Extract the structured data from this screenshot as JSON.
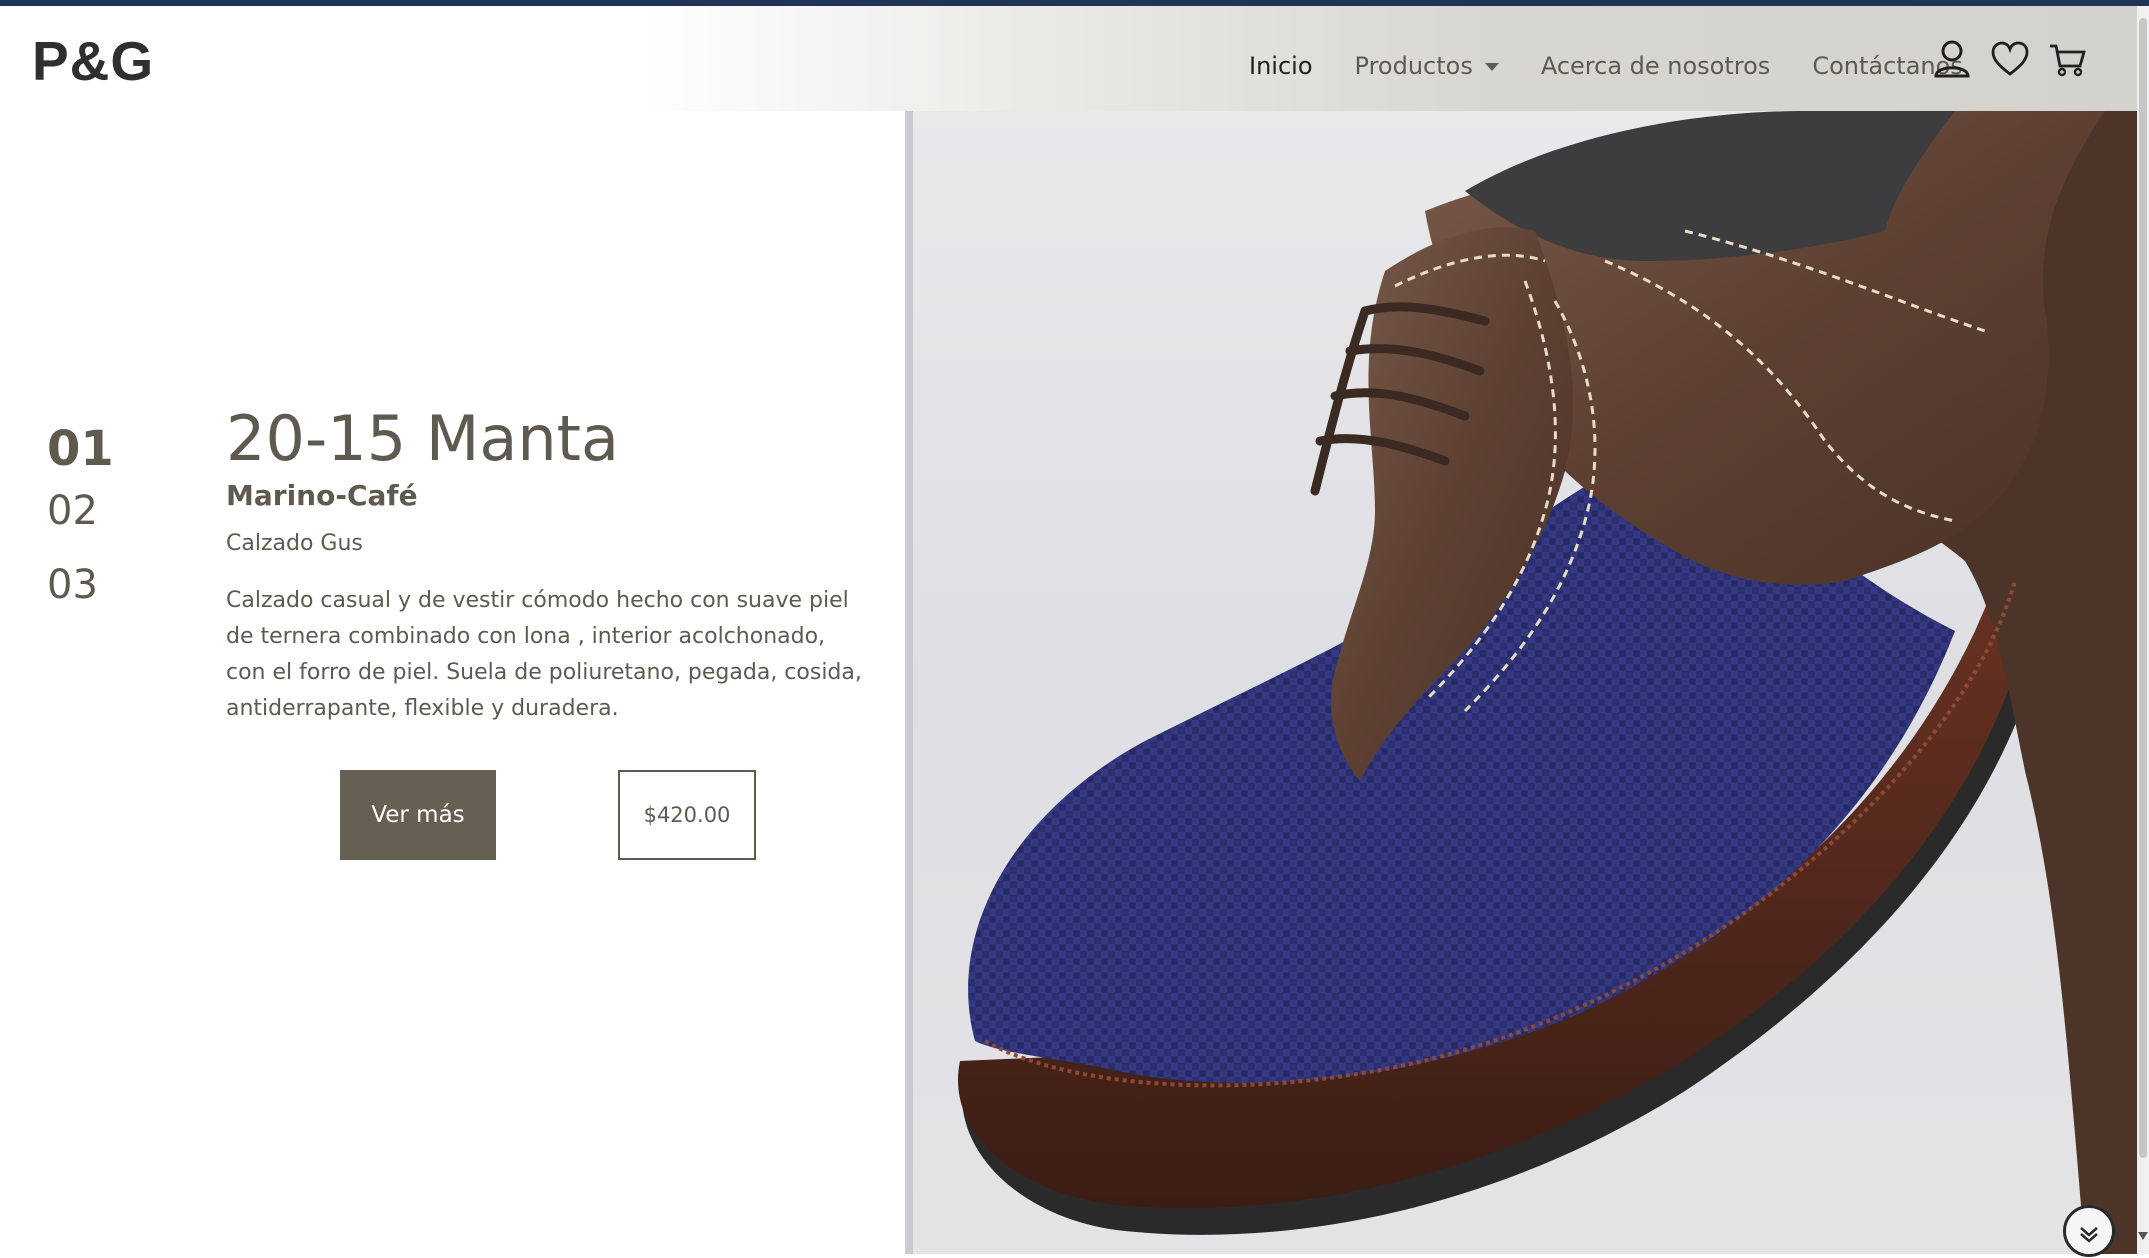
{
  "navbar": {
    "logo": "P&G",
    "links": [
      {
        "label": "Inicio"
      },
      {
        "label": "Productos"
      },
      {
        "label": "Acerca de nosotros"
      },
      {
        "label": "Contáctanos"
      }
    ],
    "icons": [
      "user-icon",
      "heart-icon",
      "cart-icon"
    ]
  },
  "slider": {
    "numbers": [
      "01",
      "02",
      "03"
    ]
  },
  "product": {
    "name": "20-15 Manta",
    "color": "Marino-Café",
    "brand": "Calzado Gus",
    "description": "Calzado casual y de vestir cómodo hecho con suave piel de ternera combinado con lona , interior acolchonado, con el forro de piel. Suela de poliuretano, pegada, cosida, antiderrapante, flexible y duradera.",
    "more_label": "Ver más",
    "price": "$420.00"
  },
  "colors": {
    "accent": "#656052",
    "text": "#5f5a50",
    "topline": "#1e3557"
  }
}
